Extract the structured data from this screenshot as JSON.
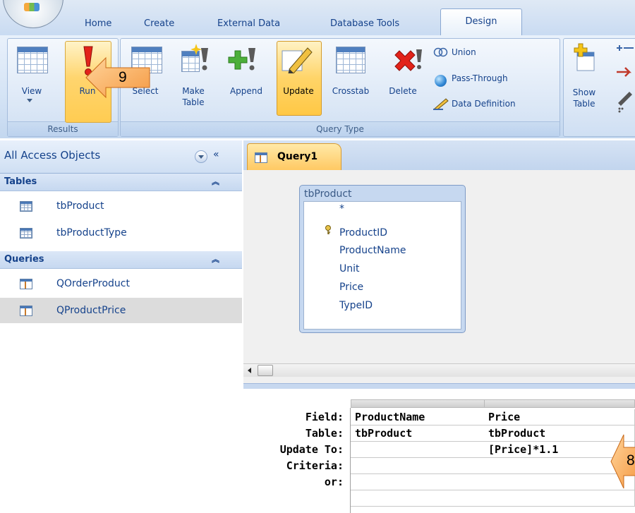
{
  "ribbon": {
    "tabs": [
      "Home",
      "Create",
      "External Data",
      "Database Tools"
    ],
    "active_tab": "Design",
    "results_group": {
      "label": "Results",
      "view_label": "View",
      "run_label": "Run"
    },
    "query_type_group": {
      "label": "Query Type",
      "select_label": "Select",
      "make_table_label_1": "Make",
      "make_table_label_2": "Table",
      "append_label": "Append",
      "update_label": "Update",
      "crosstab_label": "Crosstab",
      "delete_label": "Delete",
      "union_label": "Union",
      "passthrough_label": "Pass-Through",
      "data_definition_label": "Data Definition"
    },
    "query_setup_group": {
      "show_table_label_1": "Show",
      "show_table_label_2": "Table"
    }
  },
  "nav_pane": {
    "title": "All Access Objects",
    "collapse_glyph": "«",
    "categories": [
      {
        "label": "Tables",
        "items": [
          "tbProduct",
          "tbProductType"
        ]
      },
      {
        "label": "Queries",
        "items": [
          "QOrderProduct",
          "QProductPrice"
        ]
      }
    ],
    "selected_item": "QProductPrice"
  },
  "query_window": {
    "tab_label": "Query1",
    "field_list": {
      "table_name": "tbProduct",
      "fields": [
        "*",
        "ProductID",
        "ProductName",
        "Unit",
        "Price",
        "TypeID"
      ],
      "primary_key": "ProductID"
    },
    "design_grid": {
      "row_labels": [
        "Field:",
        "Table:",
        "Update To:",
        "Criteria:",
        "or:"
      ],
      "columns": [
        {
          "field": "ProductName",
          "table": "tbProduct",
          "update_to": "",
          "criteria": "",
          "or": ""
        },
        {
          "field": "Price",
          "table": "tbProduct",
          "update_to": "[Price]*1.1",
          "criteria": "",
          "or": ""
        }
      ]
    }
  },
  "callouts": [
    {
      "number": "9",
      "target": "Run"
    },
    {
      "number": "8",
      "target": "[Price]*1.1"
    }
  ],
  "colors": {
    "accent_orange": "#ffcc52",
    "ribbon_blue": "#c3d7ef",
    "text_blue": "#15428b"
  }
}
